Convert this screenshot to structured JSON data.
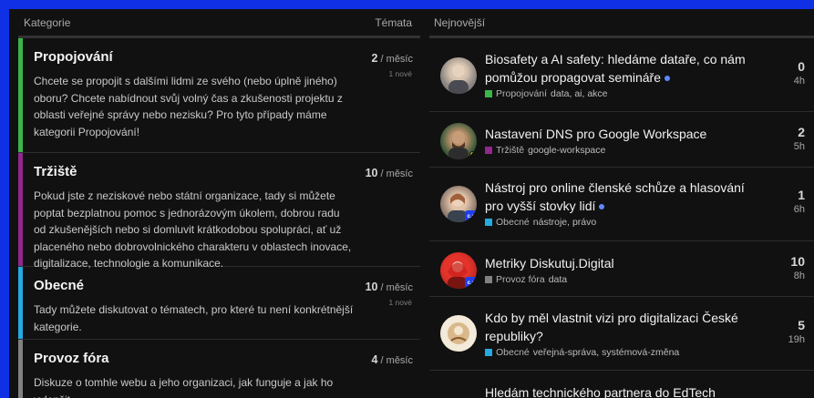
{
  "colors": {
    "window_border": "#1030e6",
    "background": "#111111",
    "propojovani": "#3ab54a",
    "trziste": "#92278f",
    "obecne": "#25aae2",
    "provoz_fora": "#808281",
    "unread_dot": "#5f89ff"
  },
  "categories_header": {
    "label": "Kategorie",
    "topics_label": "Témata"
  },
  "categories": [
    {
      "name": "Propojování",
      "description": "Chcete se propojit s dalšími lidmi ze svého (nebo úplně jiného) oboru? Chcete nabídnout svůj volný čas a zkušenosti projektu z oblasti veřejné správy nebo nezisku? Pro tyto případy máme kategorii Propojování!",
      "count": "2",
      "period": " / měsíc",
      "new": "1 nové"
    },
    {
      "name": "Tržiště",
      "description": "Pokud jste z neziskové nebo státní organizace, tady si můžete poptat bezplatnou pomoc s jednorázovým úkolem, dobrou radu od zkušenějších nebo si domluvit krátkodobou spolupráci, ať už placeného nebo dobrovolnického charakteru v oblastech inovace, digitalizace, technologie a komunikace.",
      "count": "10",
      "period": " / měsíc",
      "new": ""
    },
    {
      "name": "Obecné",
      "description": "Tady můžete diskutovat o tématech, pro které tu není konkrétnější kategorie.",
      "count": "10",
      "period": " / měsíc",
      "new": "1 nové"
    },
    {
      "name": "Provoz fóra",
      "description": "Diskuze o tomhle webu a jeho organizaci, jak funguje a jak ho vylepšit.",
      "count": "4",
      "period": " / měsíc",
      "new": ""
    }
  ],
  "latest_header": {
    "label": "Nejnovější"
  },
  "topics": [
    {
      "title": "Biosafety a AI safety: hledáme dataře, co nám pomůžou propagovat semináře",
      "unread": true,
      "category": "Propojování",
      "tags": "data, ai, akce",
      "replies": "0",
      "age": "4h"
    },
    {
      "title": "Nastavení DNS pro Google Workspace",
      "unread": false,
      "category": "Tržiště",
      "tags": "google-workspace",
      "replies": "2",
      "age": "5h"
    },
    {
      "title": "Nástroj pro online členské schůze a hlasování pro vyšší stovky lidí",
      "unread": true,
      "category": "Obecné",
      "tags": "nástroje, právo",
      "replies": "1",
      "age": "6h"
    },
    {
      "title": "Metriky Diskutuj.Digital",
      "unread": false,
      "category": "Provoz fóra",
      "tags": "data",
      "replies": "10",
      "age": "8h"
    },
    {
      "title": "Kdo by měl vlastnit vizi pro digitalizaci České republiky?",
      "unread": false,
      "category": "Obecné",
      "tags": "veřejná-správa, systémová-změna",
      "replies": "5",
      "age": "19h"
    },
    {
      "title": "Hledám technického partnera do EdTech",
      "unread": false,
      "category": "",
      "tags": "",
      "replies": "",
      "age": ""
    }
  ],
  "badge_text": "c.d"
}
